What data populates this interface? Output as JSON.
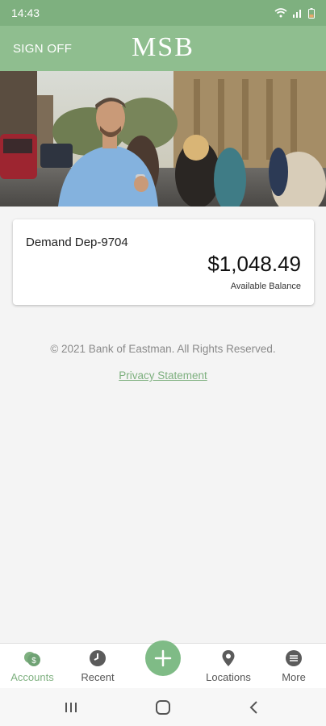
{
  "status_bar": {
    "time": "14:43"
  },
  "header": {
    "sign_off_label": "SIGN OFF",
    "logo_text": "MSB"
  },
  "accounts": [
    {
      "name": "Demand Dep-9704",
      "balance": "$1,048.49",
      "balance_label": "Available Balance"
    }
  ],
  "footer": {
    "copyright": "© 2021 Bank of Eastman. All Rights Reserved.",
    "privacy_link": "Privacy Statement"
  },
  "bottom_nav": {
    "items": [
      {
        "label": "Accounts",
        "icon": "accounts-icon",
        "active": true
      },
      {
        "label": "Recent",
        "icon": "clock-icon",
        "active": false
      },
      {
        "label": "",
        "icon": "plus-icon",
        "active": false
      },
      {
        "label": "Locations",
        "icon": "location-pin-icon",
        "active": false
      },
      {
        "label": "More",
        "icon": "more-icon",
        "active": false
      }
    ]
  },
  "colors": {
    "brand_green": "#8fbe8f",
    "status_green": "#7eb07f",
    "fab_green": "#7fbb86"
  }
}
